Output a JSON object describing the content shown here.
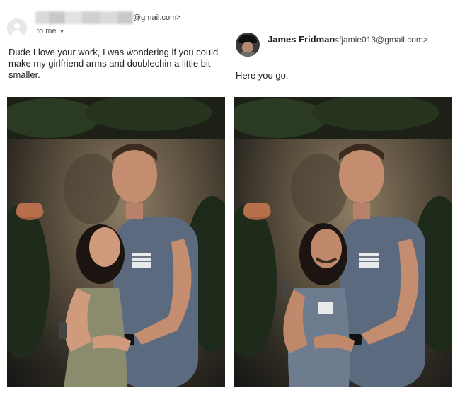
{
  "original_email": {
    "sender_email_suffix": "@gmail.com>",
    "recipient_label": "to me",
    "message": "Dude I love your work, I was wondering if you could make my girlfriend arms and doublechin a little bit smaller."
  },
  "reply_email": {
    "sender_name": "James Fridman",
    "sender_email": "<fjamie013@gmail.com>",
    "message": "Here you go."
  },
  "icons": {
    "sender_avatar": "default-user-avatar-icon",
    "recipient_caret": "chevron-down-icon",
    "reply_avatar": "profile-photo-avatar"
  },
  "colors": {
    "text": "#222222",
    "muted": "#555555",
    "avatar_bg": "#e8e8e8"
  }
}
